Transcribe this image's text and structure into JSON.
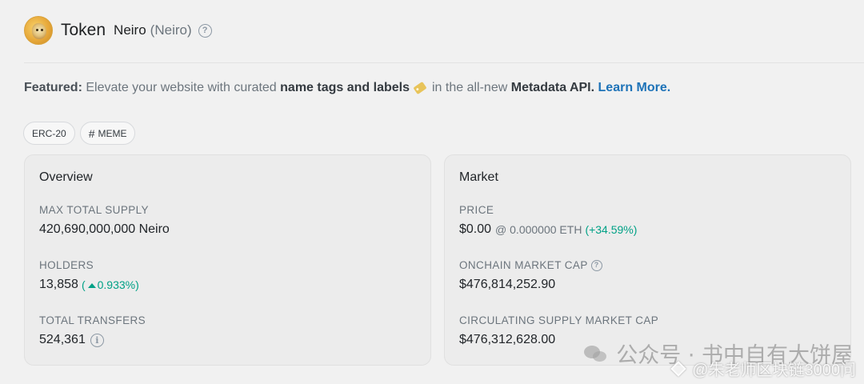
{
  "header": {
    "title": "Token",
    "name": "Neiro",
    "symbol": "(Neiro)",
    "help_icon": "question-circle-icon"
  },
  "featured": {
    "label": "Featured:",
    "text1": "Elevate your website with curated",
    "highlight": "name tags and labels",
    "text2": "in the all-new",
    "api": "Metadata API.",
    "link": "Learn More."
  },
  "badges": [
    "ERC-20",
    "MEME"
  ],
  "overview": {
    "title": "Overview",
    "max_supply_label": "MAX TOTAL SUPPLY",
    "max_supply_value": "420,690,000,000 Neiro",
    "holders_label": "HOLDERS",
    "holders_value": "13,858",
    "holders_change": "0.933%)",
    "holders_change_prefix": "(",
    "transfers_label": "TOTAL TRANSFERS",
    "transfers_value": "524,361"
  },
  "market": {
    "title": "Market",
    "price_label": "PRICE",
    "price_value": "$0.00",
    "price_eth": "@ 0.000000 ETH",
    "price_change": "(+34.59%)",
    "onchain_label": "ONCHAIN MARKET CAP",
    "onchain_value": "$476,814,252.90",
    "circ_label": "CIRCULATING SUPPLY MARKET CAP",
    "circ_value": "$476,312,628.00"
  },
  "watermark": {
    "line1": "公众号 · 书中自有大饼屋",
    "line2": "@朱老师区块链3000问"
  },
  "colors": {
    "accent": "#1e73b8",
    "positive": "#00a186",
    "muted": "#6c757d"
  }
}
